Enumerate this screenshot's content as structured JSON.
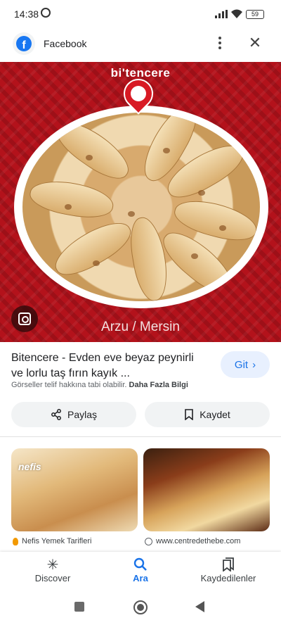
{
  "status_bar": {
    "time": "14:38",
    "battery": "59"
  },
  "browser": {
    "title": "Facebook",
    "logo_letter": "f"
  },
  "hero": {
    "brand": "bi'tencere",
    "caption": "Arzu / Mersin"
  },
  "result": {
    "title": "Bitencere - Evden eve beyaz peynirli ve lorlu taş fırın kayık ...",
    "go_label": "Git",
    "rights_text": "Görseller telif hakkına tabi olabilir.",
    "rights_link": "Daha Fazla Bilgi",
    "share_label": "Paylaş",
    "save_label": "Kaydet"
  },
  "related": [
    {
      "tag": "nefis",
      "source": "Nefis Yemek Tarifleri"
    },
    {
      "tag": "",
      "source": "www.centredethebe.com"
    }
  ],
  "bottom_nav": [
    {
      "label": "Discover",
      "icon": "asterisk-icon"
    },
    {
      "label": "Ara",
      "icon": "search-icon"
    },
    {
      "label": "Kaydedilenler",
      "icon": "bookmarks-icon"
    }
  ],
  "colors": {
    "accent": "#1a73e8",
    "hero_red": "#b3121b",
    "facebook_blue": "#1877f2"
  }
}
